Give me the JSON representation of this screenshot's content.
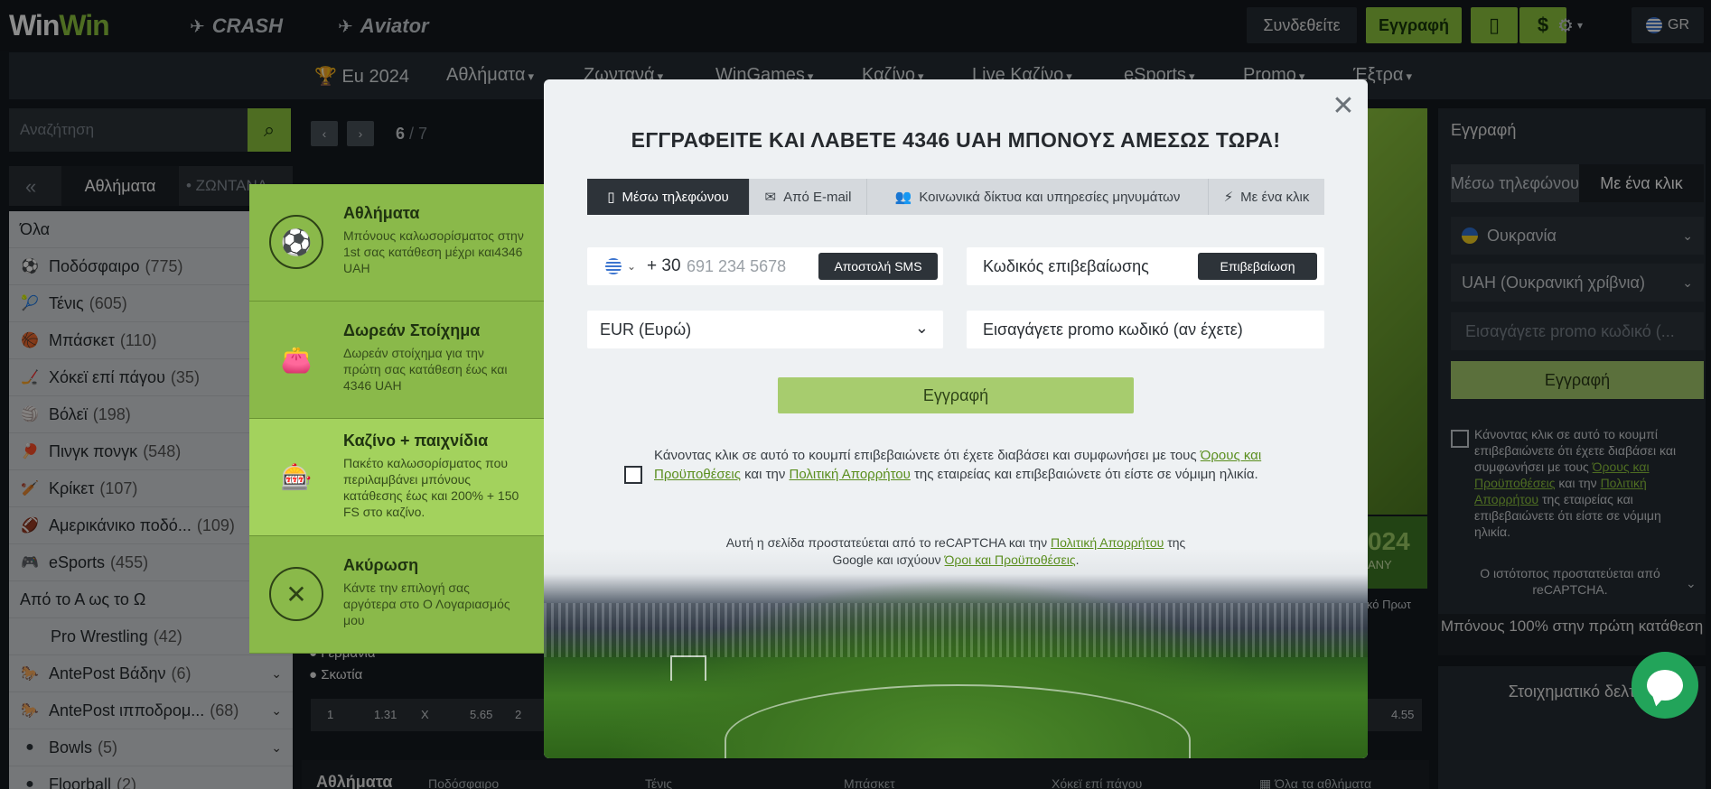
{
  "topbar": {
    "logo_a": "Win",
    "logo_b": "Win",
    "crash_label": "CRASH",
    "aviator_label": "Aviator",
    "login_label": "Συνδεθείτε",
    "register_label": "Εγγραφή",
    "phone_icon": "📱",
    "deposit_icon": "$",
    "settings_icon": "⚙",
    "lang_label": "GR"
  },
  "nav": {
    "items": [
      "Eu 2024",
      "Αθλήματα",
      "Ζωντανά",
      "WinGames",
      "Καζίνο",
      "Live Καζίνο",
      "eSports",
      "Promo",
      "Έξτρα"
    ]
  },
  "sidebar": {
    "search_placeholder": "Αναζήτηση",
    "tab_sports": "Αθλήματα",
    "tab_live": "• ΖΩΝΤΑΝΑ",
    "all_label": "Όλα",
    "items": [
      {
        "icon": "⚽",
        "label": "Ποδόσφαιρο",
        "count": "(775)"
      },
      {
        "icon": "🎾",
        "label": "Τένις",
        "count": "(605)"
      },
      {
        "icon": "🏀",
        "label": "Μπάσκετ",
        "count": "(110)"
      },
      {
        "icon": "🏒",
        "label": "Χόκεϊ επί πάγου",
        "count": "(35)"
      },
      {
        "icon": "🏐",
        "label": "Βόλεϊ",
        "count": "(198)"
      },
      {
        "icon": "🏓",
        "label": "Πινγκ πονγκ",
        "count": "(548)"
      },
      {
        "icon": "🏏",
        "label": "Κρίκετ",
        "count": "(107)"
      },
      {
        "icon": "🏈",
        "label": "Αμερικάνικο ποδό...",
        "count": "(109)"
      },
      {
        "icon": "🎮",
        "label": "eSports",
        "count": "(455)"
      }
    ],
    "az_label": "Από το Α ως το Ω",
    "extra": [
      {
        "label": "Pro Wrestling",
        "count": "(42)"
      },
      {
        "label": "AntePost Βάδην",
        "count": "(6)"
      },
      {
        "label": "AntePost ιπποδρομ...",
        "count": "(68)"
      },
      {
        "label": "Bowls",
        "count": "(5)"
      },
      {
        "label": "Floorball",
        "count": "(2)"
      }
    ]
  },
  "center": {
    "page_current": "6",
    "page_total": "/ 7",
    "team1": "Γερμανία",
    "team2": "Σκωτία",
    "odds": [
      "1",
      "1.31",
      "X",
      "5.65",
      "2",
      "4.55"
    ],
    "bottom_title": "Αθλήματα",
    "bottom_cats": [
      "Ποδόσφαιρο",
      "Τένις",
      "Μπάσκετ",
      "Χόκεϊ επί πάγου",
      "Όλα τα αθλήματα"
    ],
    "banner_year": "024",
    "banner_sub": "ANY",
    "side_snippet": "ικό Πρωτ"
  },
  "right_panel": {
    "title": "Εγγραφή",
    "tab_phone": "Μέσω τηλεφώνου",
    "tab_oneclick": "Με ένα κλικ",
    "country": "Ουκρανία",
    "currency": "UAH (Ουκρανική χρίβνια)",
    "promo_placeholder": "Εισαγάγετε promo κωδικό (...",
    "register_btn": "Εγγραφή",
    "terms_a": "Κάνοντας κλικ σε αυτό το κουμπί επιβεβαιώνετε ότι έχετε διαβάσει και συμφωνήσει με τους ",
    "terms_link1": "Όρους και Προϋποθέσεις",
    "terms_b": " και την ",
    "terms_link2": "Πολιτική Απορρήτου",
    "terms_c": " της εταιρείας και επιβεβαιώνετε ότι είστε σε νόμιμη ηλικία.",
    "captcha": "Ο ιστότοπος προστατεύεται από reCAPTCHA.",
    "bonus": "Μπόνους 100% στην πρώτη κατάθεση",
    "betslip": "Στοιχηματικό δελτ"
  },
  "promo": [
    {
      "title": "Αθλήματα",
      "desc": "Μπόνους καλωσορίσματος στην 1st σας κατάθεση μέχρι και4346 UAH",
      "icon": "⚽"
    },
    {
      "title": "Δωρεάν Στοίχημα",
      "desc": "Δωρεάν στοίχημα για την πρώτη σας κατάθεση έως και 4346 UAH",
      "icon": "👛"
    },
    {
      "title": "Καζίνο + παιχνίδια",
      "desc": "Πακέτο καλωσορίσματος που περιλαμβάνει μπόνους κατάθεσης έως και 200% + 150 FS στο καζίνο.",
      "icon": "🎰"
    },
    {
      "title": "Ακύρωση",
      "desc": "Κάντε την επιλογή σας αργότερα στο Ο Λογαριασμός μου",
      "icon": "✕"
    }
  ],
  "modal": {
    "title": "ΕΓΓΡΑΦΕΙΤΕ ΚΑΙ ΛΑΒΕΤΕ 4346 UAH ΜΠΟΝΟΥΣ ΑΜΕΣΩΣ ΤΩΡΑ!",
    "tabs": [
      {
        "icon": "▯",
        "label": "Μέσω τηλεφώνου"
      },
      {
        "icon": "✉",
        "label": "Από E-mail"
      },
      {
        "icon": "👥",
        "label": "Κοινωνικά δίκτυα και υπηρεσίες μηνυμάτων"
      },
      {
        "icon": "⚡",
        "label": "Με ένα κλικ"
      }
    ],
    "phone_code": "+ 30",
    "phone_placeholder": "691 234 5678",
    "sms_btn": "Αποστολή SMS",
    "confirm_code_label": "Κωδικός επιβεβαίωσης",
    "confirm_btn": "Επιβεβαίωση",
    "currency": "EUR (Ευρώ)",
    "promo_placeholder": "Εισαγάγετε promo κωδικό (αν έχετε)",
    "register_btn": "Εγγραφή",
    "terms_a": "Κάνοντας κλικ σε αυτό το κουμπί επιβεβαιώνετε ότι έχετε διαβάσει και συμφωνήσει με τους ",
    "terms_link1": "Όρους και Προϋποθέσεις",
    "terms_b": " και την ",
    "terms_link2": "Πολιτική Απορρήτου",
    "terms_c": " της εταιρείας και επιβεβαιώνετε ότι είστε σε νόμιμη ηλικία.",
    "captcha_a": "Αυτή η σελίδα προστατεύεται από το reCAPTCHA και την ",
    "captcha_link1": "Πολιτική Απορρήτου",
    "captcha_b": " της Google και ισχύουν ",
    "captcha_link2": "Όροι και Προϋποθέσεις",
    "captcha_c": ".",
    "close_icon": "✕"
  },
  "colors": {
    "accent": "#8fc73e",
    "dark": "#14191e",
    "panel": "#262c33"
  }
}
